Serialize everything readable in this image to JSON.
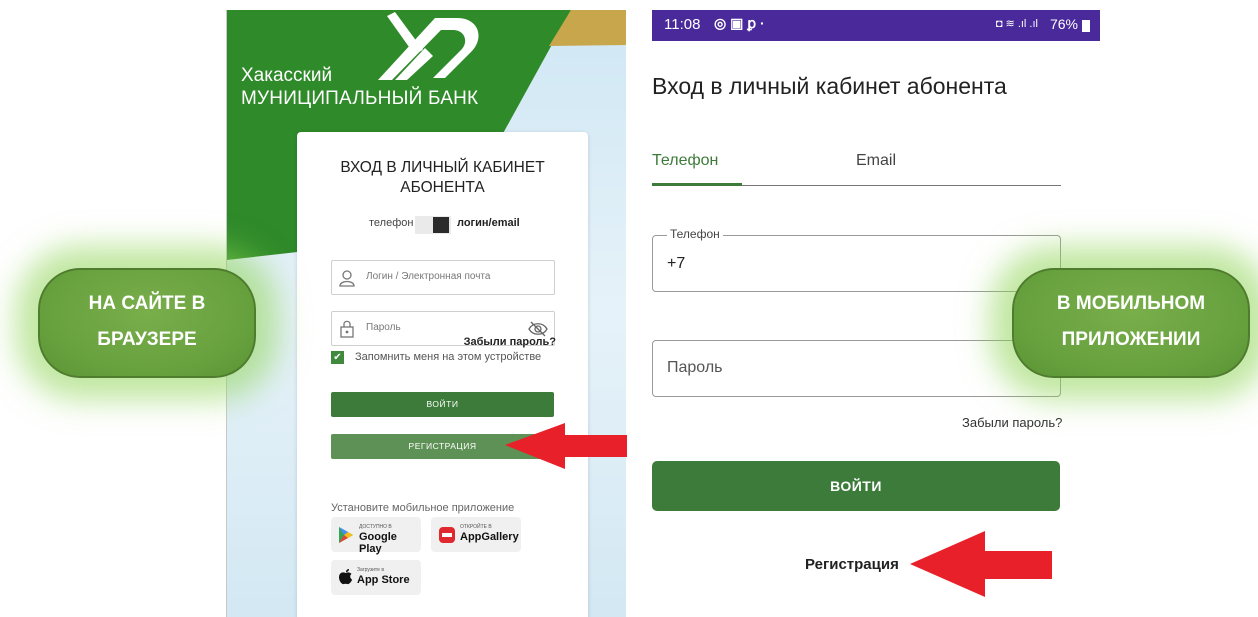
{
  "web": {
    "brand_line1": "Хакасский",
    "brand_line2": "МУНИЦИПАЛЬНЫЙ БАНК",
    "title_line1": "ВХОД В ЛИЧНЫЙ КАБИНЕТ",
    "title_line2": "АБОНЕНТА",
    "toggle_left": "телефон",
    "toggle_right": "логин/email",
    "login_placeholder": "Логин / Электронная почта",
    "password_placeholder": "Пароль",
    "forgot": "Забыли пароль?",
    "remember": "Запомнить меня на этом устройстве",
    "login_button": "ВОЙТИ",
    "register_button": "РЕГИСТРАЦИЯ",
    "install_text": "Установите мобильное приложение",
    "badges": {
      "google_small": "ДОСТУПНО В",
      "google_big": "Google Play",
      "huawei_small": "ОТКРОЙТЕ В",
      "huawei_big": "AppGallery",
      "apple_small": "Загрузите в",
      "apple_big": "App Store"
    },
    "colors": {
      "green": "#2f8a2a",
      "dark_button": "#3d7b3a",
      "register_button": "#5e9155",
      "gold": "#c8a64b"
    }
  },
  "mobile": {
    "status_time": "11:08",
    "status_right": "76%",
    "title": "Вход в личный кабинет абонента",
    "tab_phone": "Телефон",
    "tab_email": "Email",
    "phone_label": "Телефон",
    "phone_value": "+7",
    "password_placeholder": "Пароль",
    "forgot": "Забыли пароль?",
    "login_button": "ВОЙТИ",
    "register": "Регистрация",
    "colors": {
      "status_bar": "#4a2a9a",
      "accent": "#3d7b3a"
    }
  },
  "overlays": {
    "left_line1": "НА САЙТЕ В",
    "left_line2": "БРАУЗЕРЕ",
    "right_line1": "В МОБИЛЬНОМ",
    "right_line2": "ПРИЛОЖЕНИИ",
    "arrow_color": "#e8202a"
  }
}
